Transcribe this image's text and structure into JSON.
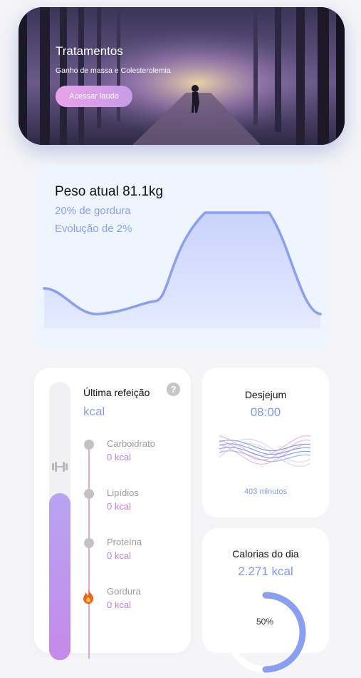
{
  "banner": {
    "title": "Tratamentos",
    "subtitle": "Ganho de massa e Colesterolemia",
    "button_label": "Acessar laudo"
  },
  "weight_card": {
    "title": "Peso atual 81.1kg",
    "fat_line": "20% de gordura",
    "evolution_line": "Evolução de 2%",
    "accent_color": "#8b9ff0"
  },
  "meal_card": {
    "title": "Última refeição",
    "help_icon": "?",
    "kcal_label": "kcal",
    "progress_fraction": 0.6,
    "nutrients": [
      {
        "label": "Carboidrato",
        "value": "0 kcal"
      },
      {
        "label": "Lipídios",
        "value": "0 kcal"
      },
      {
        "label": "Proteína",
        "value": "0 kcal"
      },
      {
        "label": "Gordura",
        "value": "0 kcal",
        "icon": "fire-icon"
      }
    ]
  },
  "fasting_card": {
    "title": "Desjejum",
    "time": "08:00",
    "minutes": "403 minutos"
  },
  "calories_card": {
    "title": "Calorias do dia",
    "value": "2.271 kcal",
    "percent_label": "50%",
    "percent": 0.5
  }
}
